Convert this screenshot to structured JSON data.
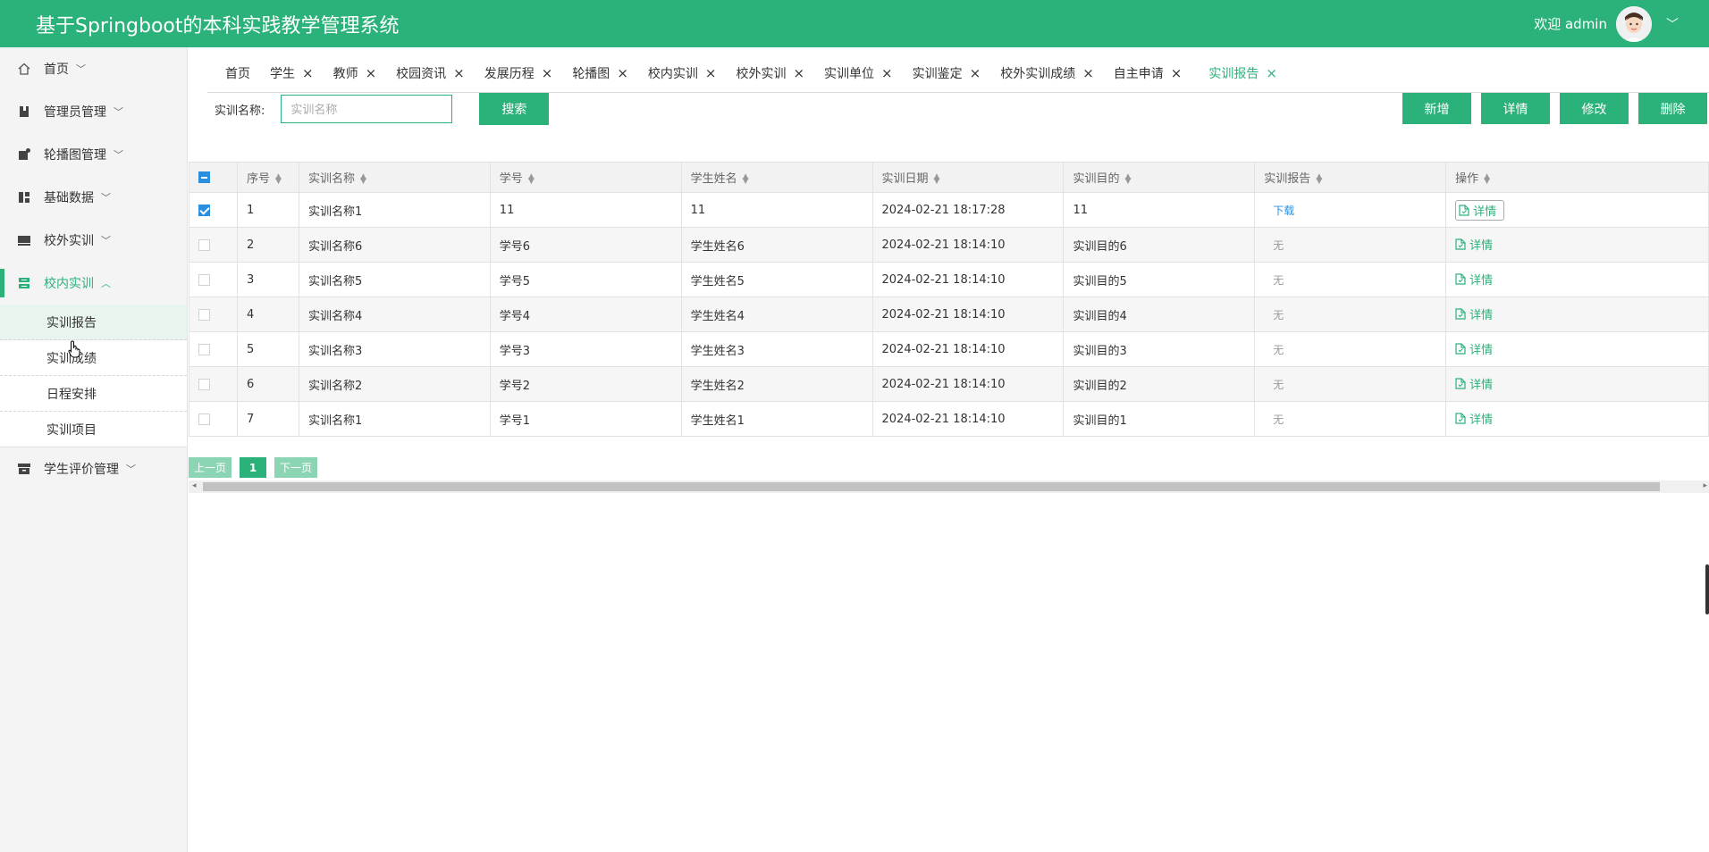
{
  "header": {
    "title": "基于Springboot的本科实践教学管理系统",
    "welcome": "欢迎 admin"
  },
  "sidebar": {
    "items": [
      {
        "label": "首页",
        "icon": "home-icon"
      },
      {
        "label": "管理员管理",
        "icon": "book-icon"
      },
      {
        "label": "轮播图管理",
        "icon": "image-icon"
      },
      {
        "label": "基础数据",
        "icon": "dashboard-icon"
      },
      {
        "label": "校外实训",
        "icon": "monitor-icon"
      },
      {
        "label": "校内实训",
        "icon": "server-icon",
        "active": true
      },
      {
        "label": "学生评价管理",
        "icon": "archive-icon"
      }
    ],
    "subitems": [
      "实训报告",
      "实训成绩",
      "日程安排",
      "实训项目"
    ]
  },
  "tabs": [
    "首页",
    "学生",
    "教师",
    "校园资讯",
    "发展历程",
    "轮播图",
    "校内实训",
    "校外实训",
    "实训单位",
    "实训鉴定",
    "校外实训成绩",
    "自主申请",
    "实训报告"
  ],
  "search": {
    "label": "实训名称:",
    "placeholder": "实训名称",
    "button": "搜索"
  },
  "actions": [
    "新增",
    "详情",
    "修改",
    "删除"
  ],
  "table": {
    "headers": [
      "序号",
      "实训名称",
      "学号",
      "学生姓名",
      "实训日期",
      "实训目的",
      "实训报告",
      "操作"
    ],
    "rows": [
      {
        "no": "1",
        "name": "实训名称1",
        "sid": "11",
        "sname": "11",
        "date": "2024-02-21 18:17:28",
        "purpose": "11",
        "report": "下载",
        "op": "详情",
        "checked": true
      },
      {
        "no": "2",
        "name": "实训名称6",
        "sid": "学号6",
        "sname": "学生姓名6",
        "date": "2024-02-21 18:14:10",
        "purpose": "实训目的6",
        "report": "无",
        "op": "详情",
        "checked": false
      },
      {
        "no": "3",
        "name": "实训名称5",
        "sid": "学号5",
        "sname": "学生姓名5",
        "date": "2024-02-21 18:14:10",
        "purpose": "实训目的5",
        "report": "无",
        "op": "详情",
        "checked": false
      },
      {
        "no": "4",
        "name": "实训名称4",
        "sid": "学号4",
        "sname": "学生姓名4",
        "date": "2024-02-21 18:14:10",
        "purpose": "实训目的4",
        "report": "无",
        "op": "详情",
        "checked": false
      },
      {
        "no": "5",
        "name": "实训名称3",
        "sid": "学号3",
        "sname": "学生姓名3",
        "date": "2024-02-21 18:14:10",
        "purpose": "实训目的3",
        "report": "无",
        "op": "详情",
        "checked": false
      },
      {
        "no": "6",
        "name": "实训名称2",
        "sid": "学号2",
        "sname": "学生姓名2",
        "date": "2024-02-21 18:14:10",
        "purpose": "实训目的2",
        "report": "无",
        "op": "详情",
        "checked": false
      },
      {
        "no": "7",
        "name": "实训名称1",
        "sid": "学号1",
        "sname": "学生姓名1",
        "date": "2024-02-21 18:14:10",
        "purpose": "实训目的1",
        "report": "无",
        "op": "详情",
        "checked": false
      }
    ]
  },
  "pagination": {
    "prev": "上一页",
    "current": "1",
    "next": "下一页"
  },
  "colors": {
    "primary": "#2bb27a",
    "link": "#2b8fe0"
  }
}
